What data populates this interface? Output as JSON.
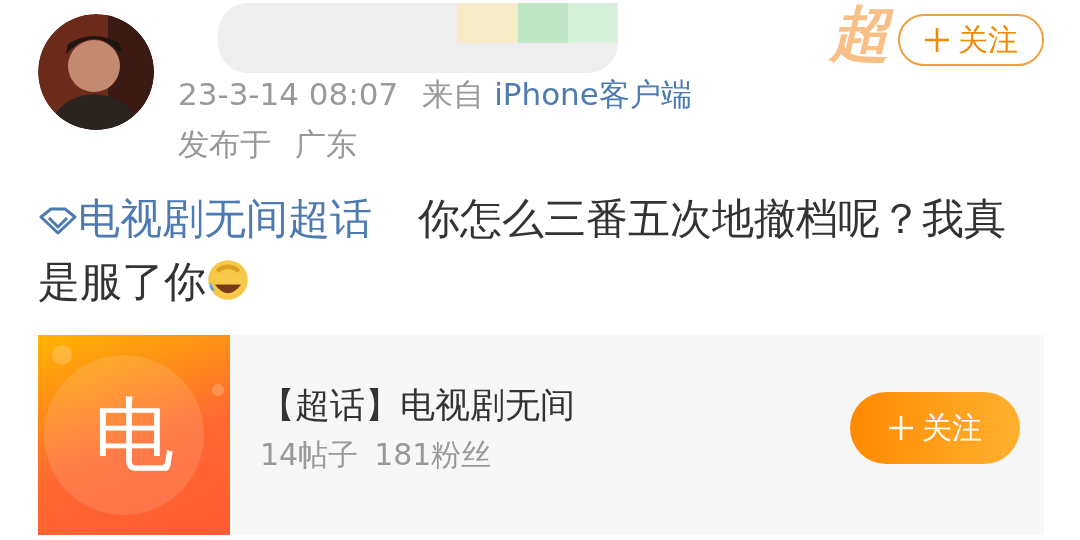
{
  "post": {
    "banner_text": "超",
    "follow_button": {
      "label": "关注",
      "filled": false
    },
    "time": "23-3-14  08:07",
    "source_prefix": "来自",
    "source": "iPhone客户端",
    "location_prefix": "发布于",
    "location": "广东",
    "topic_link": "电视剧无间超话",
    "text": "你怎么三番五次地撤档呢？我真是服了你"
  },
  "topic_card": {
    "badge": "电",
    "title": "【超话】电视剧无间",
    "posts": "14帖子",
    "fans": "181粉丝",
    "follow_button": {
      "label": "关注",
      "filled": true
    }
  }
}
